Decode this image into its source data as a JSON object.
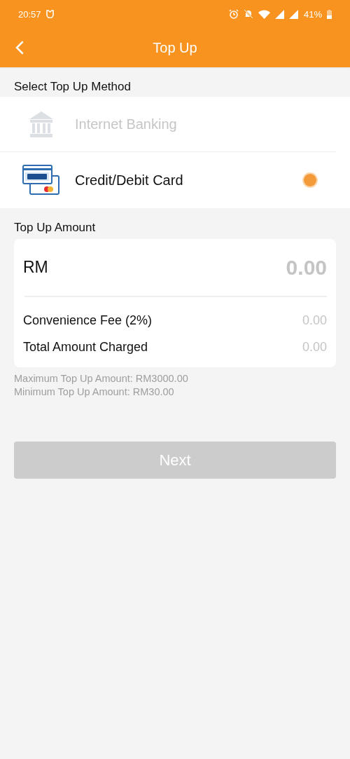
{
  "status_bar": {
    "time": "20:57",
    "battery": "41%"
  },
  "header": {
    "title": "Top Up"
  },
  "method_section": {
    "label": "Select Top Up Method",
    "methods": [
      {
        "kind": "bank",
        "label": "Internet Banking",
        "disabled": true,
        "selected": false
      },
      {
        "kind": "card",
        "label": "Credit/Debit Card",
        "disabled": false,
        "selected": true
      }
    ]
  },
  "amount_section": {
    "label": "Top Up Amount",
    "currency": "RM",
    "placeholder": "0.00",
    "rows": [
      {
        "label": "Convenience Fee (2%)",
        "value": "0.00"
      },
      {
        "label": "Total Amount Charged",
        "value": "0.00"
      }
    ],
    "notes": [
      "Maximum Top Up Amount: RM3000.00",
      "Minimum Top Up Amount: RM30.00"
    ]
  },
  "next_button": {
    "label": "Next",
    "disabled": true
  }
}
